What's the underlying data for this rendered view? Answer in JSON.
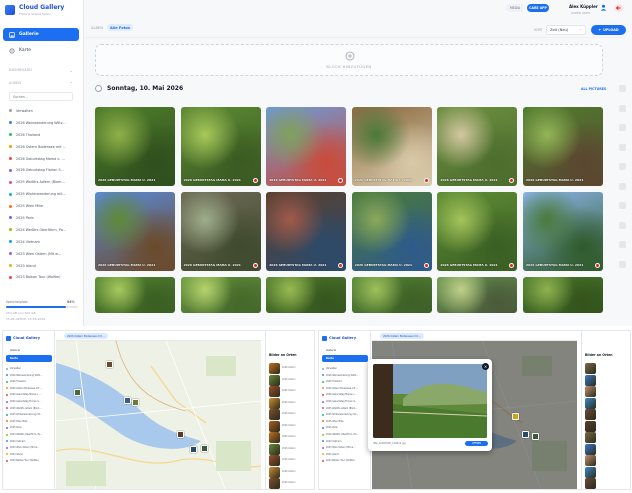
{
  "app": {
    "title": "Cloud Gallery",
    "subtitle": "Fotos & Videos teilen"
  },
  "sidebar": {
    "nav": [
      {
        "label": "Gallerie",
        "active": true,
        "icon": "gallery-icon"
      },
      {
        "label": "Karte",
        "active": false,
        "icon": "map-icon"
      }
    ],
    "section_shared": "Dashboard",
    "section_albums": "Alben",
    "search_placeholder": "Suchen...",
    "albums": [
      {
        "label": "Verwalten",
        "color": "#94a3b8"
      },
      {
        "label": "2026 Weinwanderung Wiltz...",
        "color": "#3b82f6"
      },
      {
        "label": "2026 Thailand",
        "color": "#22c55e"
      },
      {
        "label": "2026 Ostern Bodensee mit ...",
        "color": "#f59e0b"
      },
      {
        "label": "2026 Geburtstag Mama u. ...",
        "color": "#ef4444"
      },
      {
        "label": "2026 Geburtstag Florian S...",
        "color": "#8b5cf6"
      },
      {
        "label": "2025 Weißfrs Adlern (Blom...",
        "color": "#ec4899"
      },
      {
        "label": "2025 Winterwanderung mit...",
        "color": "#14b8a6"
      },
      {
        "label": "2025 Wien Mike",
        "color": "#f97316"
      },
      {
        "label": "2025 Paris",
        "color": "#6366f1"
      },
      {
        "label": "2024 Weißfrs Oberföhrn, Po...",
        "color": "#84cc16"
      },
      {
        "label": "2024 Vietnam",
        "color": "#0ea5e9"
      },
      {
        "label": "2023 Wien Ostern (Mit w...",
        "color": "#a855f7"
      },
      {
        "label": "2023 Island",
        "color": "#eab308"
      },
      {
        "label": "2023 Balkan Tour (Wolfke)",
        "color": "#ef4444"
      }
    ],
    "storage_label": "Speicherplatz",
    "storage_pct_label": "84%",
    "storage_fraction": 0.84,
    "storage_used": "254 GB von 300 GB",
    "storage_date": "15.05 AKTIVE, 15.05.2026"
  },
  "topbar": {
    "pill_a": "MEDIA",
    "pill_b": "CARE APP",
    "user_name": "Alex Küppler",
    "user_role": "SUPER USER"
  },
  "toolbar": {
    "tab_a": "ALBEN",
    "tab_b": "Alle Fotos",
    "sort_label": "SORT",
    "sort_value": "Zeit (Neu)",
    "upload_label": "UPLOAD"
  },
  "dropzone": {
    "text": "BLOCK HINZUFÜGEN"
  },
  "day": {
    "title": "Sonntag, 10. Mai 2026",
    "select_all": "ALL PICTURES"
  },
  "tiles": [
    {
      "caption": "2026 GEBURTSTAG MAMA U. 2021",
      "colors": [
        "#4e7d2a",
        "#8fb04a",
        "#2f4f1d"
      ],
      "badge": false
    },
    {
      "caption": "2026 GEBURTSTAG MAMA U. 2021",
      "colors": [
        "#5d8a33",
        "#a7c85a",
        "#3a5a22"
      ],
      "badge": true
    },
    {
      "caption": "2026 GEBURTSTAG MAMA U. 2021",
      "colors": [
        "#6d9ad8",
        "#7fa25a",
        "#c94b3a"
      ],
      "badge": true
    },
    {
      "caption": "2026 GEBURTSTAG MAMA U. 2021",
      "colors": [
        "#8a6a42",
        "#4a7a3a",
        "#d9c9a8"
      ],
      "badge": true
    },
    {
      "caption": "2026 GEBURTSTAG MAMA U. 2021",
      "colors": [
        "#6b8f3e",
        "#d4c7a1",
        "#4d6d2e"
      ],
      "badge": true
    },
    {
      "caption": "2026 GEBURTSTAG MAMA U. 2021",
      "colors": [
        "#4f7e2e",
        "#93b557",
        "#5b4630"
      ],
      "badge": false
    },
    {
      "caption": "2026 GEBURTSTAG MAMA U. 2021",
      "colors": [
        "#5b8ad9",
        "#5f8a36",
        "#6b4a2a"
      ],
      "badge": false
    },
    {
      "caption": "2026 GEBURTSTAG MAMA U. 2021",
      "colors": [
        "#6d6a55",
        "#9fae8c",
        "#3f4a2e"
      ],
      "badge": true
    },
    {
      "caption": "2026 GEBURTSTAG MAMA U. 2021",
      "colors": [
        "#5a4030",
        "#a05a4a",
        "#2c4a6a"
      ],
      "badge": true
    },
    {
      "caption": "2026 GEBURTSTAG MAMA U. 2021",
      "colors": [
        "#4a7a3a",
        "#8aa95a",
        "#2e5a8a"
      ],
      "badge": true
    },
    {
      "caption": "2026 GEBURTSTAG MAMA U. 2021",
      "colors": [
        "#5e8d34",
        "#a4c35b",
        "#3b5f24"
      ],
      "badge": true
    },
    {
      "caption": "2026 GEBURTSTAG MAMA U. 2021",
      "colors": [
        "#8bb4e8",
        "#4a7a3a",
        "#2f5a2a"
      ],
      "badge": true
    },
    {
      "caption": "",
      "colors": [
        "#5a8a34",
        "#a8c85e",
        "#3a5f22"
      ],
      "badge": false
    },
    {
      "caption": "",
      "colors": [
        "#6a9a40",
        "#b7d26e",
        "#45682a"
      ],
      "badge": false
    },
    {
      "caption": "",
      "colors": [
        "#557f30",
        "#98ba52",
        "#35561f"
      ],
      "badge": false
    },
    {
      "caption": "",
      "colors": [
        "#5a8a3a",
        "#9fc05a",
        "#3d6026"
      ],
      "badge": false
    },
    {
      "caption": "",
      "colors": [
        "#6a9a50",
        "#c0d08a",
        "#4a5a3a"
      ],
      "badge": false
    },
    {
      "caption": "",
      "colors": [
        "#4f7f2f",
        "#8fb04f",
        "#33531c"
      ],
      "badge": false
    }
  ],
  "map_panel_left": {
    "title": "Cloud Gallery",
    "nav_a": "Gallerie",
    "nav_b": "Karte",
    "chip": "2026 Ostern Bodensee mit ...",
    "user": "Alex Küppler",
    "list_title": "Bilder an Orten",
    "list_labels": [
      "2026 Ostern",
      "2026 Ostern",
      "2026 Ostern",
      "2026 Ostern",
      "2026 Ostern",
      "2026 Ostern",
      "2026 Ostern",
      "2026 Ostern",
      "2026 Ostern",
      "2026 Ostern",
      "2026 Ostern"
    ]
  },
  "map_panel_right": {
    "title": "Cloud Gallery",
    "nav_a": "Gallerie",
    "nav_b": "Karte",
    "chip": "2026 Ostern Bodensee mit ...",
    "user": "Alex Küppler",
    "list_title": "Bilder an Orten",
    "modal_caption": "IMG_20260405_104412.jpg",
    "modal_button": "ÖFFNEN"
  }
}
